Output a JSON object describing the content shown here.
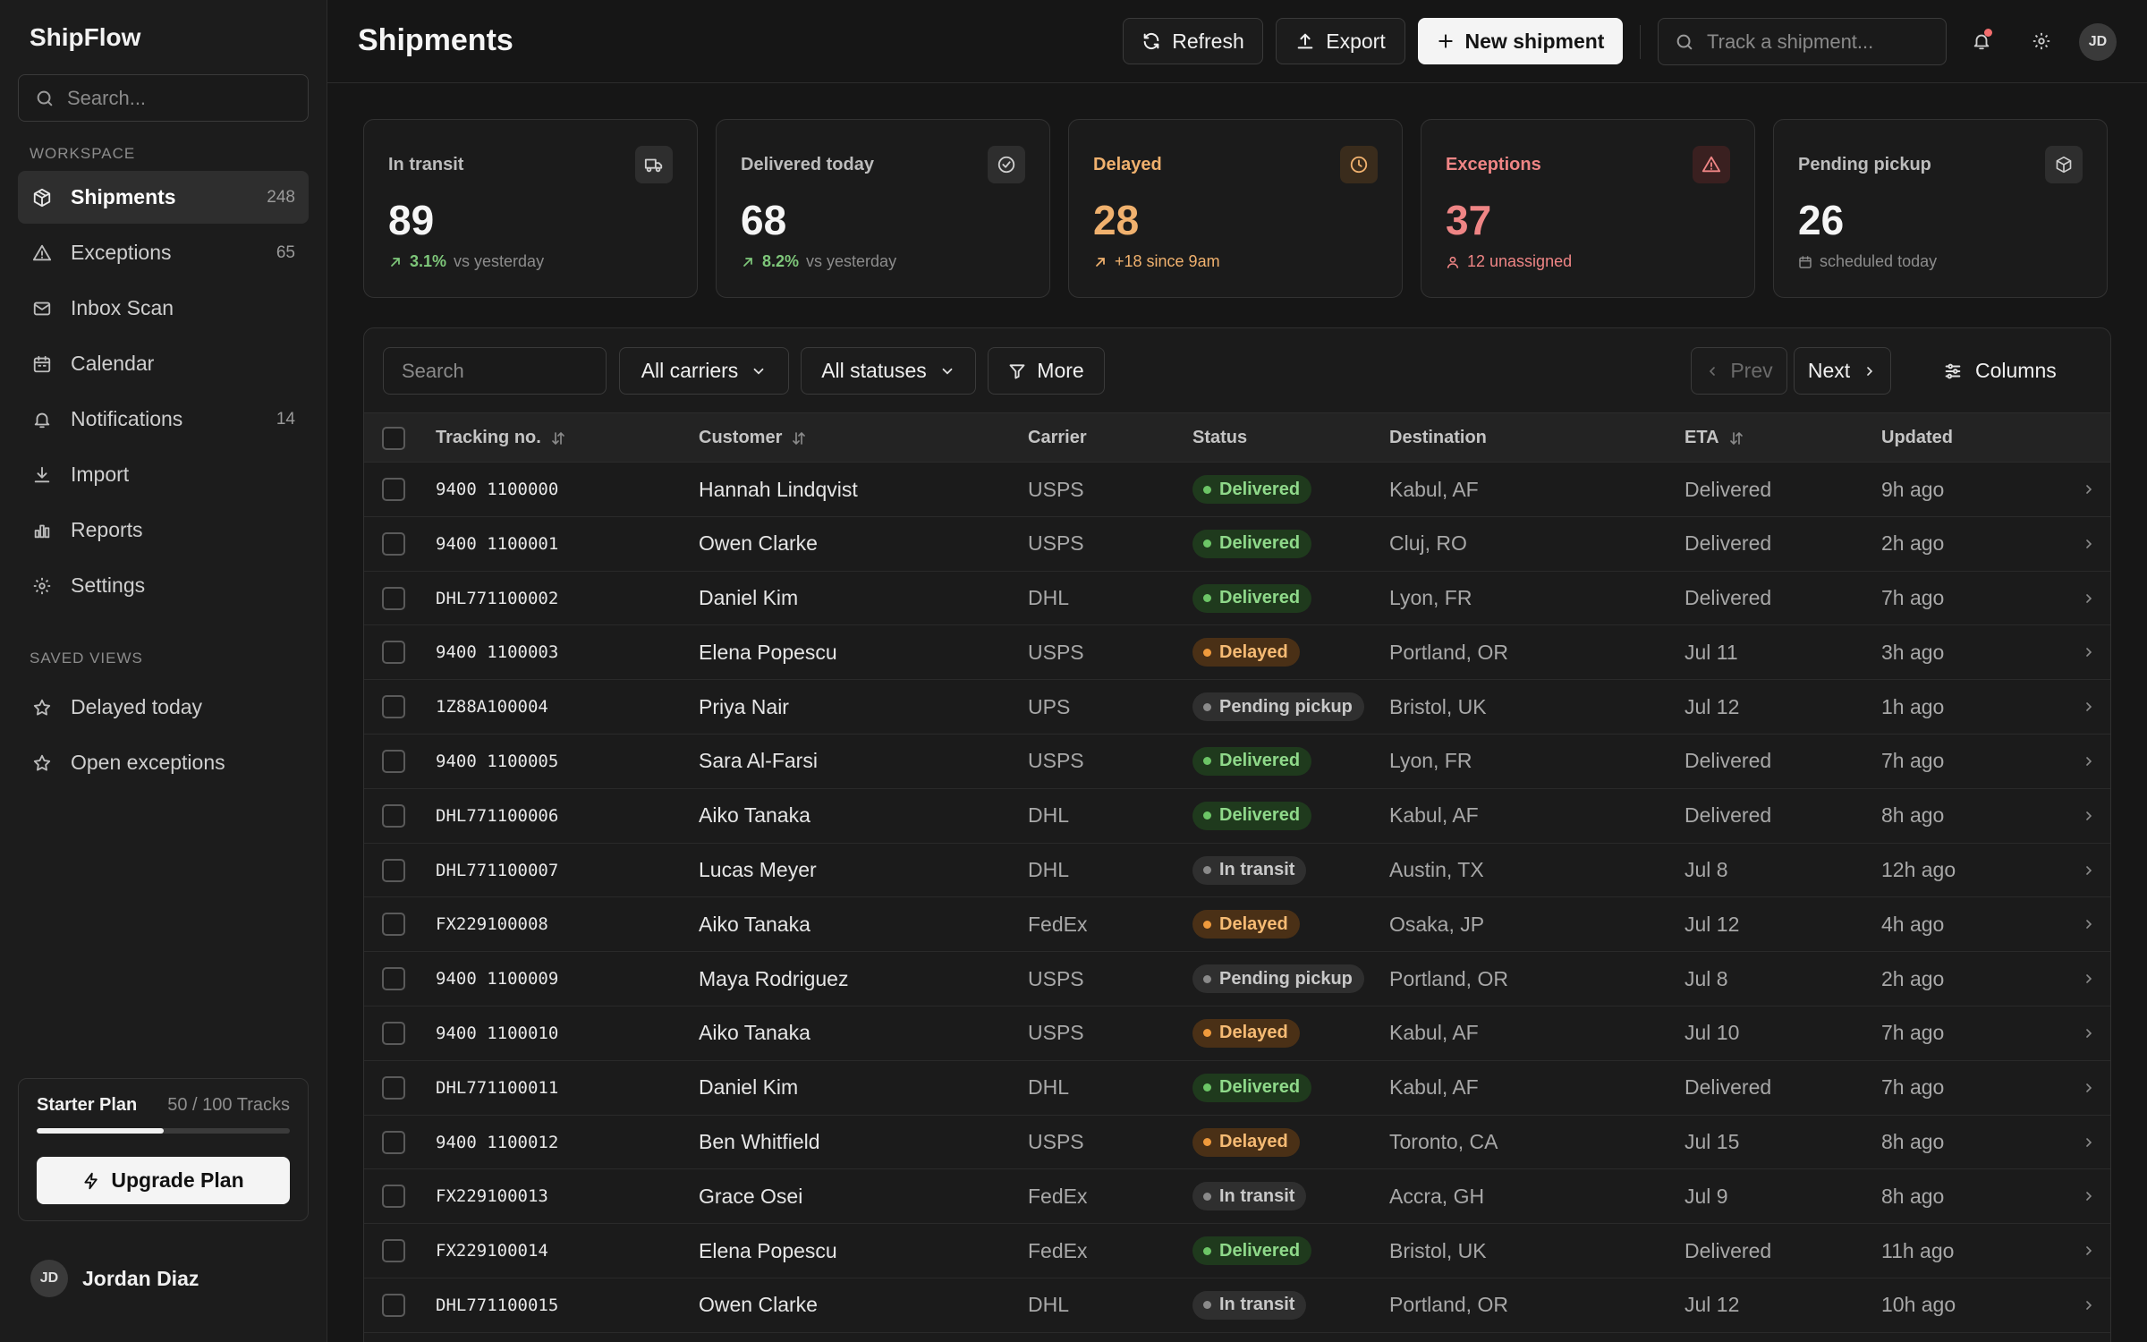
{
  "sidebar": {
    "brand": "ShipFlow",
    "search_placeholder": "Search...",
    "workspace_label": "WORKSPACE",
    "items": [
      {
        "label": "Shipments",
        "count": "248",
        "icon": "package-icon"
      },
      {
        "label": "Exceptions",
        "count": "65",
        "icon": "warning-icon"
      },
      {
        "label": "Inbox Scan",
        "count": "",
        "icon": "mail-icon"
      },
      {
        "label": "Calendar",
        "count": "",
        "icon": "calendar-icon"
      },
      {
        "label": "Notifications",
        "count": "14",
        "icon": "bell-icon"
      },
      {
        "label": "Import",
        "count": "",
        "icon": "download-icon"
      },
      {
        "label": "Reports",
        "count": "",
        "icon": "bar-chart-icon"
      },
      {
        "label": "Settings",
        "count": "",
        "icon": "gear-icon"
      }
    ],
    "saved_views_label": "SAVED VIEWS",
    "saved_views": [
      {
        "label": "Delayed today",
        "icon": "star-icon"
      },
      {
        "label": "Open exceptions",
        "icon": "star-icon"
      }
    ],
    "plan": {
      "name": "Starter Plan",
      "usage": "50 / 100 Tracks",
      "progress": 0.5,
      "upgrade_label": "Upgrade Plan"
    },
    "user": {
      "initials": "JD",
      "name": "Jordan Diaz"
    }
  },
  "header": {
    "title": "Shipments",
    "refresh_label": "Refresh",
    "export_label": "Export",
    "new_label": "New shipment",
    "track_placeholder": "Track a shipment...",
    "avatar_initials": "JD"
  },
  "stats": [
    {
      "label": "In transit",
      "value": "89",
      "delta": "3.1%",
      "sub": "vs yesterday"
    },
    {
      "label": "Delivered today",
      "value": "68",
      "delta": "8.2%",
      "sub": "vs yesterday"
    },
    {
      "label": "Delayed",
      "value": "28",
      "sub": "+18 since 9am"
    },
    {
      "label": "Exceptions",
      "value": "37",
      "sub": "12 unassigned"
    },
    {
      "label": "Pending pickup",
      "value": "26",
      "sub": "scheduled today"
    }
  ],
  "filters": {
    "search_placeholder": "Search",
    "carriers": "All carriers",
    "statuses": "All statuses",
    "more": "More",
    "prev": "Prev",
    "next": "Next",
    "columns": "Columns"
  },
  "table": {
    "headers": {
      "tracking": "Tracking no.",
      "customer": "Customer",
      "carrier": "Carrier",
      "status": "Status",
      "destination": "Destination",
      "eta": "ETA",
      "updated": "Updated"
    },
    "rows": [
      {
        "tracking": "9400 1100000",
        "customer": "Hannah Lindqvist",
        "carrier": "USPS",
        "status": "Delivered",
        "status_key": "delivered",
        "destination": "Kabul, AF",
        "eta": "Delivered",
        "updated": "9h ago"
      },
      {
        "tracking": "9400 1100001",
        "customer": "Owen Clarke",
        "carrier": "USPS",
        "status": "Delivered",
        "status_key": "delivered",
        "destination": "Cluj, RO",
        "eta": "Delivered",
        "updated": "2h ago"
      },
      {
        "tracking": "DHL771100002",
        "customer": "Daniel Kim",
        "carrier": "DHL",
        "status": "Delivered",
        "status_key": "delivered",
        "destination": "Lyon, FR",
        "eta": "Delivered",
        "updated": "7h ago"
      },
      {
        "tracking": "9400 1100003",
        "customer": "Elena Popescu",
        "carrier": "USPS",
        "status": "Delayed",
        "status_key": "delayed",
        "destination": "Portland, OR",
        "eta": "Jul 11",
        "updated": "3h ago"
      },
      {
        "tracking": "1Z88A100004",
        "customer": "Priya Nair",
        "carrier": "UPS",
        "status": "Pending pickup",
        "status_key": "pending",
        "destination": "Bristol, UK",
        "eta": "Jul 12",
        "updated": "1h ago"
      },
      {
        "tracking": "9400 1100005",
        "customer": "Sara Al-Farsi",
        "carrier": "USPS",
        "status": "Delivered",
        "status_key": "delivered",
        "destination": "Lyon, FR",
        "eta": "Delivered",
        "updated": "7h ago"
      },
      {
        "tracking": "DHL771100006",
        "customer": "Aiko Tanaka",
        "carrier": "DHL",
        "status": "Delivered",
        "status_key": "delivered",
        "destination": "Kabul, AF",
        "eta": "Delivered",
        "updated": "8h ago"
      },
      {
        "tracking": "DHL771100007",
        "customer": "Lucas Meyer",
        "carrier": "DHL",
        "status": "In transit",
        "status_key": "transit",
        "destination": "Austin, TX",
        "eta": "Jul 8",
        "updated": "12h ago"
      },
      {
        "tracking": "FX229100008",
        "customer": "Aiko Tanaka",
        "carrier": "FedEx",
        "status": "Delayed",
        "status_key": "delayed",
        "destination": "Osaka, JP",
        "eta": "Jul 12",
        "updated": "4h ago"
      },
      {
        "tracking": "9400 1100009",
        "customer": "Maya Rodriguez",
        "carrier": "USPS",
        "status": "Pending pickup",
        "status_key": "pending",
        "destination": "Portland, OR",
        "eta": "Jul 8",
        "updated": "2h ago"
      },
      {
        "tracking": "9400 1100010",
        "customer": "Aiko Tanaka",
        "carrier": "USPS",
        "status": "Delayed",
        "status_key": "delayed",
        "destination": "Kabul, AF",
        "eta": "Jul 10",
        "updated": "7h ago"
      },
      {
        "tracking": "DHL771100011",
        "customer": "Daniel Kim",
        "carrier": "DHL",
        "status": "Delivered",
        "status_key": "delivered",
        "destination": "Kabul, AF",
        "eta": "Delivered",
        "updated": "7h ago"
      },
      {
        "tracking": "9400 1100012",
        "customer": "Ben Whitfield",
        "carrier": "USPS",
        "status": "Delayed",
        "status_key": "delayed",
        "destination": "Toronto, CA",
        "eta": "Jul 15",
        "updated": "8h ago"
      },
      {
        "tracking": "FX229100013",
        "customer": "Grace Osei",
        "carrier": "FedEx",
        "status": "In transit",
        "status_key": "transit",
        "destination": "Accra, GH",
        "eta": "Jul 9",
        "updated": "8h ago"
      },
      {
        "tracking": "FX229100014",
        "customer": "Elena Popescu",
        "carrier": "FedEx",
        "status": "Delivered",
        "status_key": "delivered",
        "destination": "Bristol, UK",
        "eta": "Delivered",
        "updated": "11h ago"
      },
      {
        "tracking": "DHL771100015",
        "customer": "Owen Clarke",
        "carrier": "DHL",
        "status": "In transit",
        "status_key": "transit",
        "destination": "Portland, OR",
        "eta": "Jul 12",
        "updated": "10h ago"
      }
    ]
  },
  "colors": {
    "accent_green": "#6cc566",
    "accent_orange": "#ef9a3c",
    "accent_red": "#ef8585",
    "bell_dot": "#f26d6d"
  }
}
